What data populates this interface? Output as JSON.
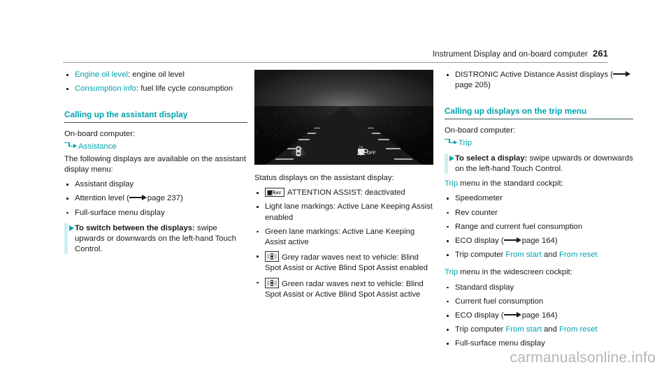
{
  "running_head": {
    "title": "Instrument Display and on-board computer",
    "page_number": "261"
  },
  "colors": {
    "teal": "#00a3ad",
    "rule": "#3c5558",
    "step_bar": "#cdf0f1",
    "watermark": "#b5b5b5"
  },
  "left_column": {
    "bullets_top": [
      {
        "term": "Engine oil level",
        "rest": ": engine oil level"
      },
      {
        "term": "Consumption info",
        "rest": ": fuel life cycle consumption"
      }
    ],
    "heading": "Calling up the assistant display",
    "obc_label": "On-board computer:",
    "menu_path": "Assistance",
    "intro": "The following displays are available on the assistant display menu:",
    "bullets": [
      {
        "text": "Assistant display"
      },
      {
        "text_before": "Attention level (",
        "xref_page": "page 237",
        "text_after": ")"
      },
      {
        "text": "Full-surface menu display"
      }
    ],
    "step": {
      "bold": "To switch between the displays:",
      "rest": " swipe upwards or downwards on the left-hand Touch Control."
    }
  },
  "middle_column": {
    "figure": {
      "name": "assistant-display-road-view",
      "icons": [
        "vehicle-with-lane-icon",
        "attention-assist-off-icon"
      ],
      "icon_label": "OFF"
    },
    "caption": "Status displays on the assistant display:",
    "bullets": [
      {
        "icon": "attention-assist-off-badge",
        "icon_label": "OFF",
        "text": "ATTENTION ASSIST: deactivated"
      },
      {
        "text": "Light lane markings: Active Lane Keeping Assist enabled"
      },
      {
        "text": "Green lane markings: Active Lane Keeping Assist active"
      },
      {
        "icon": "blind-spot-grey-badge",
        "text": "Grey radar waves next to vehicle: Blind Spot Assist or Active Blind Spot Assist enabled"
      },
      {
        "icon": "blind-spot-green-badge",
        "text": "Green radar waves next to vehicle: Blind Spot Assist or Active Blind Spot Assist active"
      }
    ]
  },
  "right_column": {
    "bullet_top": {
      "text_before": "DISTRONIC Active Distance Assist displays (",
      "xref_page": "page 205",
      "text_after": ")"
    },
    "heading": "Calling up displays on the trip menu",
    "obc_label": "On-board computer:",
    "menu_path": "Trip",
    "step": {
      "bold": "To select a display:",
      "rest": " swipe upwards or downwards on the left-hand Touch Control."
    },
    "standard_intro": {
      "menu": "Trip",
      "rest": " menu in the standard cockpit:"
    },
    "standard_bullets": [
      {
        "text": "Speedometer"
      },
      {
        "text": "Rev counter"
      },
      {
        "text": "Range and current fuel consumption"
      },
      {
        "text_before": "ECO display (",
        "xref_page": "page 164",
        "text_after": ")"
      },
      {
        "text_before": "Trip computer ",
        "teal_a": "From start",
        "mid": " and ",
        "teal_b": "From reset"
      }
    ],
    "widescreen_intro": {
      "menu": "Trip",
      "rest": " menu in the widescreen cockpit:"
    },
    "widescreen_bullets": [
      {
        "text": "Standard display"
      },
      {
        "text": "Current fuel consumption"
      },
      {
        "text_before": "ECO display (",
        "xref_page": "page 164",
        "text_after": ")"
      },
      {
        "text_before": "Trip computer ",
        "teal_a": "From start",
        "mid": " and ",
        "teal_b": "From reset"
      },
      {
        "text": "Full-surface menu display"
      }
    ]
  },
  "watermark": "carmanualsonline.info"
}
